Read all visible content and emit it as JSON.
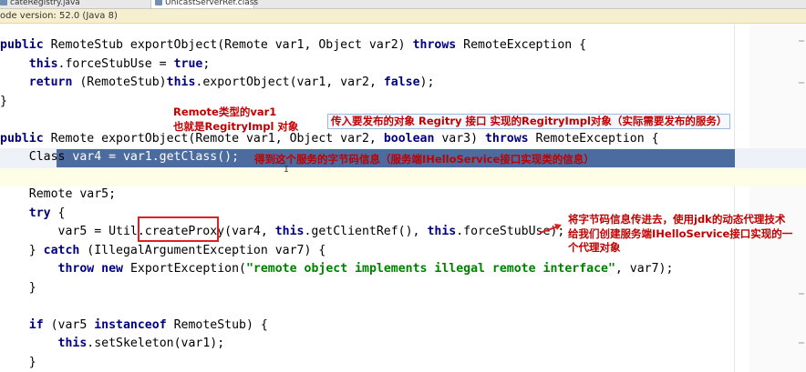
{
  "tabs": [
    {
      "label": "cateRegistry.java",
      "active": false,
      "icon": "java-class-icon"
    },
    {
      "label": "UnicastServerRef.class",
      "active": true,
      "icon": "class-file-icon"
    }
  ],
  "infobar": {
    "text": "ode version: 52.0 (Java 8)"
  },
  "code": {
    "lines": [
      "public RemoteStub exportObject(Remote var1, Object var2) throws RemoteException {",
      "    this.forceStubUse = true;",
      "    return (RemoteStub)this.exportObject(var1, var2, false);",
      "}",
      "",
      "public Remote exportObject(Remote var1, Object var2, boolean var3) throws RemoteException {",
      "    Class var4 = var1.getClass();",
      "",
      "    Remote var5;",
      "    try {",
      "        var5 = Util.createProxy(var4, this.getClientRef(), this.forceStubUse);",
      "    } catch (IllegalArgumentException var7) {",
      "        throw new ExportException(\"remote object implements illegal remote interface\", var7);",
      "    }",
      "",
      "    if (var5 instanceof RemoteStub) {",
      "        this.setSkeleton(var1);",
      "    }"
    ]
  },
  "annotations": {
    "remote_type_1": "Remote类型的var1",
    "remote_type_2": "也就是RegitryImpl 对象",
    "publish": "传入要发布的对象 Regitry  接口 实现的RegitryImpl对象（实际需要发布的服务）",
    "bytecode": "得到这个服务的字节码信息（服务端IHelloService接口实现类的信息）",
    "proxy_1": "将字节码信息传进去，使用jdk的动态代理技术",
    "proxy_2": "给我们创建服务端IHelloService接口实现的一",
    "proxy_3": "个代理对象"
  },
  "colors": {
    "keyword": "#000080",
    "string": "#008000",
    "annotation": "#c00000",
    "selection": "#4c6b9e",
    "highlight_box": "#e02020"
  }
}
